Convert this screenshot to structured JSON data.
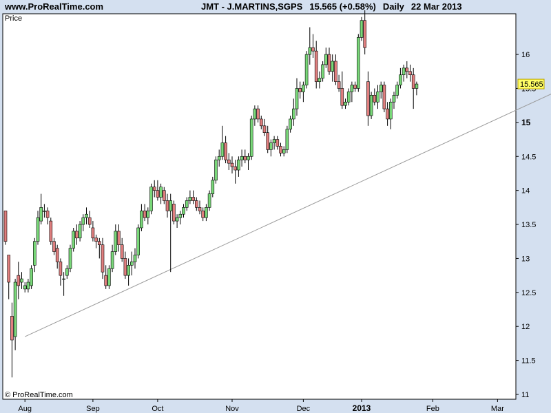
{
  "header": {
    "site": "www.ProRealTime.com",
    "symbol": "JMT - J.MARTINS,SGPS",
    "price": "15.565 (+0.58%)",
    "period": "Daily",
    "date": "22 Mar 2013"
  },
  "panel_label": "Price",
  "copyright": "© ProRealTime.com",
  "last_price_label": "15.565",
  "colors": {
    "up": "#79d879",
    "down": "#e07f7f",
    "background": "#d4e0f0",
    "plot": "#ffffff",
    "price_badge": "#ffff66"
  },
  "chart_data": {
    "type": "candlestick",
    "ylim": [
      11,
      16.75
    ],
    "yticks": [
      {
        "v": 16,
        "label": "16",
        "bold": false
      },
      {
        "v": 15.5,
        "label": "15.5",
        "bold": false
      },
      {
        "v": 15,
        "label": "15",
        "bold": true
      },
      {
        "v": 14.5,
        "label": "14.5",
        "bold": false
      },
      {
        "v": 14,
        "label": "14",
        "bold": false
      },
      {
        "v": 13.5,
        "label": "13.5",
        "bold": false
      },
      {
        "v": 13,
        "label": "13",
        "bold": false
      },
      {
        "v": 12.5,
        "label": "12.5",
        "bold": false
      },
      {
        "v": 12,
        "label": "12",
        "bold": false
      },
      {
        "v": 11.5,
        "label": "11.5",
        "bold": false
      },
      {
        "v": 11,
        "label": "11",
        "bold": false
      }
    ],
    "xticks": [
      {
        "i": 6,
        "label": "Aug",
        "bold": false
      },
      {
        "i": 27,
        "label": "Sep",
        "bold": false
      },
      {
        "i": 47,
        "label": "Oct",
        "bold": false
      },
      {
        "i": 70,
        "label": "Nov",
        "bold": false
      },
      {
        "i": 92,
        "label": "Dec",
        "bold": false
      },
      {
        "i": 110,
        "label": "2013",
        "bold": true
      },
      {
        "i": 132,
        "label": "Feb",
        "bold": false
      },
      {
        "i": 152,
        "label": "Mar",
        "bold": false
      }
    ],
    "trendline": {
      "from": [
        6,
        11.85
      ],
      "to": [
        170,
        15.45
      ]
    },
    "ohlc": [
      [
        13.7,
        13.7,
        13.2,
        13.25
      ],
      [
        13.05,
        13.05,
        12.4,
        12.65
      ],
      [
        12.15,
        12.35,
        11.25,
        11.8
      ],
      [
        11.85,
        12.7,
        11.65,
        12.65
      ],
      [
        12.75,
        12.95,
        12.4,
        12.6
      ],
      [
        12.65,
        12.8,
        12.55,
        12.7
      ],
      [
        12.55,
        12.65,
        12.5,
        12.6
      ],
      [
        12.55,
        12.7,
        12.5,
        12.65
      ],
      [
        12.6,
        12.9,
        12.55,
        12.85
      ],
      [
        12.9,
        13.3,
        12.8,
        13.25
      ],
      [
        13.25,
        13.7,
        13.2,
        13.6
      ],
      [
        13.55,
        13.95,
        13.5,
        13.75
      ],
      [
        13.7,
        13.8,
        13.6,
        13.7
      ],
      [
        13.7,
        13.75,
        13.5,
        13.6
      ],
      [
        13.55,
        13.6,
        13.2,
        13.25
      ],
      [
        13.25,
        13.3,
        13.05,
        13.1
      ],
      [
        13.15,
        13.2,
        12.85,
        12.95
      ],
      [
        12.95,
        13.0,
        12.6,
        12.75
      ],
      [
        12.7,
        12.8,
        12.45,
        12.7
      ],
      [
        12.75,
        12.9,
        12.7,
        12.85
      ],
      [
        12.85,
        13.2,
        12.8,
        13.15
      ],
      [
        13.15,
        13.45,
        13.1,
        13.4
      ],
      [
        13.4,
        13.5,
        13.2,
        13.3
      ],
      [
        13.3,
        13.55,
        13.25,
        13.5
      ],
      [
        13.5,
        13.65,
        13.4,
        13.6
      ],
      [
        13.6,
        13.75,
        13.5,
        13.65
      ],
      [
        13.6,
        13.7,
        13.45,
        13.5
      ],
      [
        13.45,
        13.55,
        13.25,
        13.3
      ],
      [
        13.3,
        13.35,
        13.15,
        13.25
      ],
      [
        13.25,
        13.3,
        13.0,
        13.2
      ],
      [
        13.2,
        13.3,
        12.7,
        12.8
      ],
      [
        12.75,
        12.9,
        12.55,
        12.6
      ],
      [
        12.6,
        12.9,
        12.55,
        12.85
      ],
      [
        12.85,
        13.2,
        12.8,
        13.1
      ],
      [
        13.1,
        13.5,
        13.05,
        13.4
      ],
      [
        13.4,
        13.5,
        13.1,
        13.2
      ],
      [
        13.2,
        13.3,
        12.95,
        13.0
      ],
      [
        13.0,
        13.1,
        12.7,
        12.75
      ],
      [
        12.75,
        13.0,
        12.6,
        12.9
      ],
      [
        12.9,
        13.1,
        12.75,
        12.95
      ],
      [
        12.95,
        13.15,
        12.85,
        13.05
      ],
      [
        13.05,
        13.5,
        13.0,
        13.45
      ],
      [
        13.45,
        13.8,
        13.4,
        13.7
      ],
      [
        13.7,
        13.8,
        13.55,
        13.6
      ],
      [
        13.6,
        13.75,
        13.5,
        13.7
      ],
      [
        13.7,
        14.1,
        13.65,
        14.05
      ],
      [
        14.05,
        14.15,
        13.9,
        14.0
      ],
      [
        14.0,
        14.15,
        13.85,
        13.9
      ],
      [
        13.9,
        14.1,
        13.8,
        14.05
      ],
      [
        14.0,
        14.05,
        13.8,
        13.85
      ],
      [
        13.85,
        13.95,
        13.6,
        13.7
      ],
      [
        13.7,
        13.95,
        12.8,
        13.85
      ],
      [
        13.8,
        13.85,
        13.5,
        13.55
      ],
      [
        13.55,
        13.65,
        13.45,
        13.6
      ],
      [
        13.6,
        13.7,
        13.5,
        13.65
      ],
      [
        13.65,
        13.8,
        13.6,
        13.75
      ],
      [
        13.75,
        13.9,
        13.7,
        13.85
      ],
      [
        13.85,
        14.0,
        13.8,
        13.9
      ],
      [
        13.9,
        14.0,
        13.8,
        13.85
      ],
      [
        13.85,
        13.9,
        13.7,
        13.75
      ],
      [
        13.75,
        13.85,
        13.65,
        13.7
      ],
      [
        13.7,
        13.75,
        13.55,
        13.6
      ],
      [
        13.6,
        13.8,
        13.55,
        13.75
      ],
      [
        13.75,
        14.0,
        13.7,
        13.95
      ],
      [
        13.95,
        14.2,
        13.9,
        14.15
      ],
      [
        14.15,
        14.5,
        14.1,
        14.45
      ],
      [
        14.45,
        14.6,
        14.35,
        14.5
      ],
      [
        14.5,
        14.95,
        14.45,
        14.7
      ],
      [
        14.7,
        14.8,
        14.4,
        14.45
      ],
      [
        14.45,
        14.55,
        14.3,
        14.4
      ],
      [
        14.4,
        14.5,
        14.25,
        14.35
      ],
      [
        14.35,
        14.45,
        14.1,
        14.3
      ],
      [
        14.3,
        14.5,
        14.2,
        14.45
      ],
      [
        14.45,
        14.6,
        14.35,
        14.5
      ],
      [
        14.5,
        14.6,
        14.4,
        14.45
      ],
      [
        14.45,
        14.55,
        14.3,
        14.5
      ],
      [
        14.5,
        15.1,
        14.45,
        15.05
      ],
      [
        15.05,
        15.25,
        14.95,
        15.2
      ],
      [
        15.2,
        15.25,
        15.0,
        15.05
      ],
      [
        15.05,
        15.1,
        14.9,
        14.95
      ],
      [
        14.95,
        15.05,
        14.8,
        14.85
      ],
      [
        14.85,
        14.95,
        14.55,
        14.6
      ],
      [
        14.6,
        14.75,
        14.5,
        14.7
      ],
      [
        14.7,
        14.8,
        14.6,
        14.75
      ],
      [
        14.75,
        14.8,
        14.6,
        14.65
      ],
      [
        14.65,
        14.7,
        14.5,
        14.55
      ],
      [
        14.55,
        14.65,
        14.5,
        14.6
      ],
      [
        14.6,
        14.95,
        14.55,
        14.9
      ],
      [
        14.9,
        15.1,
        14.85,
        15.05
      ],
      [
        15.05,
        15.35,
        14.95,
        15.2
      ],
      [
        15.2,
        15.65,
        15.1,
        15.5
      ],
      [
        15.5,
        15.6,
        15.35,
        15.45
      ],
      [
        15.45,
        15.6,
        15.3,
        15.55
      ],
      [
        15.55,
        16.05,
        15.5,
        16.0
      ],
      [
        16.0,
        16.4,
        15.85,
        16.1
      ],
      [
        16.1,
        16.3,
        15.95,
        16.05
      ],
      [
        16.05,
        16.2,
        15.5,
        15.6
      ],
      [
        15.6,
        15.75,
        15.5,
        15.65
      ],
      [
        15.65,
        15.9,
        15.6,
        15.85
      ],
      [
        15.85,
        16.1,
        15.8,
        16.0
      ],
      [
        16.0,
        16.1,
        15.7,
        15.75
      ],
      [
        15.75,
        16.0,
        15.6,
        15.9
      ],
      [
        15.9,
        16.0,
        15.55,
        15.6
      ],
      [
        15.6,
        15.7,
        15.45,
        15.5
      ],
      [
        15.5,
        15.75,
        15.2,
        15.25
      ],
      [
        15.25,
        15.35,
        15.2,
        15.3
      ],
      [
        15.3,
        15.5,
        15.25,
        15.45
      ],
      [
        15.45,
        15.6,
        15.3,
        15.55
      ],
      [
        15.55,
        15.6,
        15.45,
        15.5
      ],
      [
        15.5,
        16.3,
        15.45,
        16.25
      ],
      [
        16.25,
        16.55,
        16.2,
        16.5
      ],
      [
        16.5,
        16.65,
        16.0,
        16.1
      ],
      [
        15.6,
        15.75,
        14.95,
        15.1
      ],
      [
        15.1,
        15.45,
        15.05,
        15.4
      ],
      [
        15.4,
        15.5,
        15.25,
        15.3
      ],
      [
        15.3,
        15.55,
        15.2,
        15.45
      ],
      [
        15.45,
        15.6,
        15.35,
        15.55
      ],
      [
        15.55,
        15.6,
        15.15,
        15.2
      ],
      [
        15.2,
        15.3,
        14.95,
        15.05
      ],
      [
        15.05,
        15.35,
        14.9,
        15.3
      ],
      [
        15.3,
        15.45,
        15.2,
        15.4
      ],
      [
        15.4,
        15.6,
        15.35,
        15.55
      ],
      [
        15.55,
        15.8,
        15.5,
        15.7
      ],
      [
        15.7,
        15.85,
        15.6,
        15.8
      ],
      [
        15.8,
        15.9,
        15.65,
        15.75
      ],
      [
        15.75,
        15.85,
        15.6,
        15.7
      ],
      [
        15.7,
        15.8,
        15.2,
        15.5
      ],
      [
        15.5,
        15.6,
        15.4,
        15.565
      ]
    ]
  }
}
